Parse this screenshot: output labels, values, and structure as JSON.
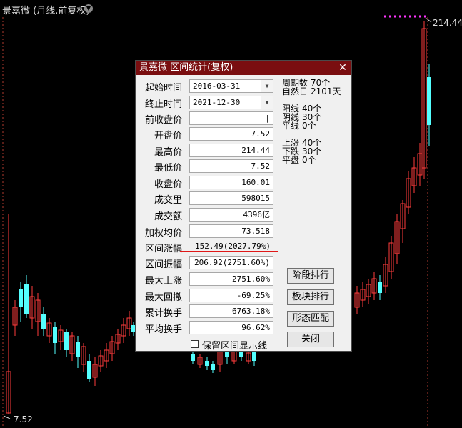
{
  "chart_header": {
    "title": "景嘉微 (月线.前复权)"
  },
  "price_labels": {
    "high": "214.44",
    "low": "7.52"
  },
  "colors": {
    "up": "#ff3c3c",
    "down": "#54ffff",
    "marker": "#ff36ff",
    "dialog_title_bg": "#7a0e10"
  },
  "chart_data": {
    "type": "candlestick",
    "symbol": "景嘉微",
    "period": "月线",
    "adjust": "前复权",
    "high": 214.44,
    "low": 7.52
  },
  "dialog": {
    "title": "景嘉微 区间统计(复权)",
    "close_icon": "close-icon",
    "rows": [
      {
        "label": "起始时间",
        "value": "2016-03-31",
        "dropdown": true
      },
      {
        "label": "终止时间",
        "value": "2021-12-30",
        "dropdown": true
      },
      {
        "label": "前收盘价",
        "value": "|"
      },
      {
        "label": "开盘价",
        "value": "7.52"
      },
      {
        "label": "最高价",
        "value": "214.44"
      },
      {
        "label": "最低价",
        "value": "7.52"
      },
      {
        "label": "收盘价",
        "value": "160.01"
      },
      {
        "label": "成交里",
        "value": "598015"
      },
      {
        "label": "成交额",
        "value": "4396亿"
      },
      {
        "label": "加权均价",
        "value": "73.518"
      },
      {
        "label": "区间涨幅",
        "value": "152.49(2027.79%)"
      },
      {
        "label": "区间振幅",
        "value": "206.92(2751.60%)"
      },
      {
        "label": "最大上涨",
        "value": "2751.60%"
      },
      {
        "label": "最大回撤",
        "value": "-69.25%"
      },
      {
        "label": "累计换手",
        "value": "6763.18%"
      },
      {
        "label": "平均换手",
        "value": "96.62%"
      }
    ],
    "stats": [
      {
        "k": "周期数",
        "v": "70个"
      },
      {
        "k": "自然日",
        "v": "2101天"
      },
      {
        "k": "阳线",
        "v": "40个"
      },
      {
        "k": "阴线",
        "v": "30个"
      },
      {
        "k": "平线",
        "v": "0个"
      },
      {
        "k": "上涨",
        "v": "40个"
      },
      {
        "k": "下跌",
        "v": "30个"
      },
      {
        "k": "平盘",
        "v": "0个"
      }
    ],
    "buttons": [
      "阶段排行",
      "板块排行",
      "形态匹配",
      "关闭"
    ],
    "checkbox_label": "保留区间显示线"
  }
}
